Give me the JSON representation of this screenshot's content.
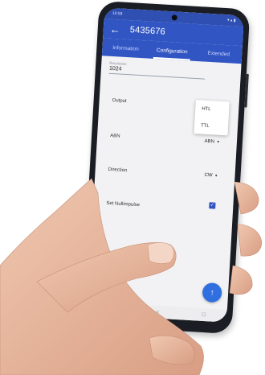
{
  "app": {
    "title": "5435676",
    "status_left": "10:59",
    "status_right": "▾ ▴ ▮"
  },
  "tabs": [
    {
      "label": "Information"
    },
    {
      "label": "Configuration"
    },
    {
      "label": "Extended"
    }
  ],
  "resolution": {
    "label": "Resolution",
    "value": "1024"
  },
  "rows": {
    "output": {
      "label": "Output"
    },
    "abn": {
      "label": "ABN",
      "value": "ABN"
    },
    "direction": {
      "label": "Direction",
      "value": "CW"
    },
    "nullimpulse": {
      "label": "Set Nullimpulse"
    }
  },
  "dropdown": {
    "options": [
      "HTL",
      "TTL"
    ]
  },
  "icons": {
    "back": "←",
    "caret": "▾",
    "check": "✓",
    "fab": "↑",
    "nav_back": "◁",
    "nav_home": "○",
    "nav_recent": "□"
  },
  "colors": {
    "appbar": "#3156c4",
    "fab": "#2f6fe0",
    "skin": "#e7b9a0"
  }
}
